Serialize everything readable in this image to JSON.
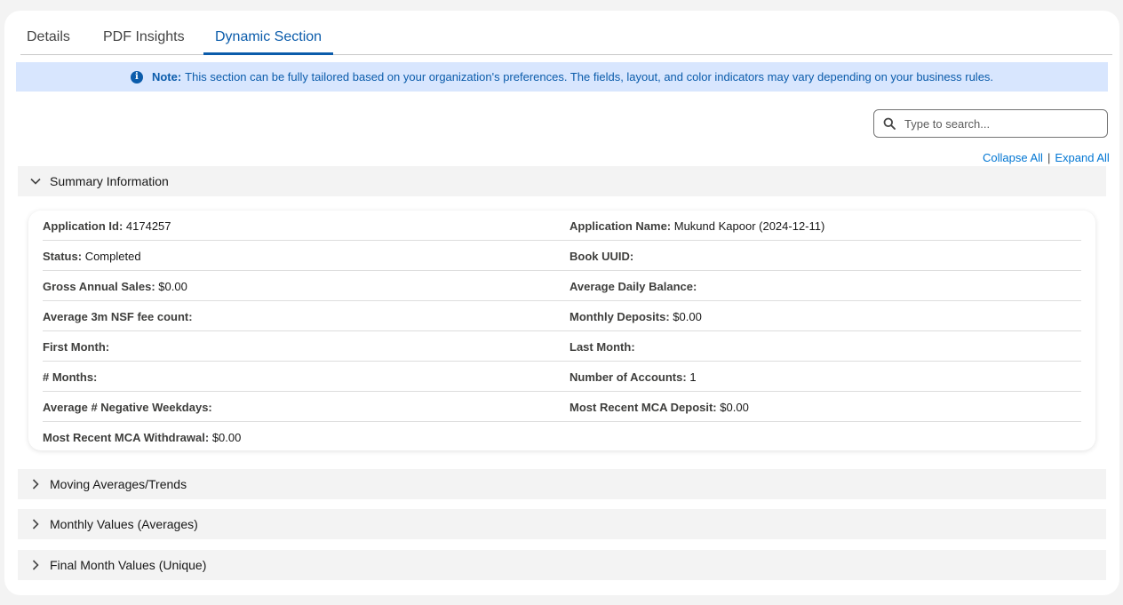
{
  "tabs": [
    {
      "label": "Details",
      "active": false
    },
    {
      "label": "PDF Insights",
      "active": false
    },
    {
      "label": "Dynamic Section",
      "active": true
    }
  ],
  "note": {
    "prefix": "Note:",
    "text": "This section can be fully tailored based on your organization's preferences. The fields, layout, and color indicators may vary depending on your business rules."
  },
  "search": {
    "placeholder": "Type to search...",
    "value": ""
  },
  "links": {
    "collapse_all": "Collapse All",
    "separator": "|",
    "expand_all": "Expand All"
  },
  "sections": [
    {
      "title": "Summary Information",
      "expanded": true
    },
    {
      "title": "Moving Averages/Trends",
      "expanded": false
    },
    {
      "title": "Monthly Values (Averages)",
      "expanded": false
    },
    {
      "title": "Final Month Values (Unique)",
      "expanded": false
    }
  ],
  "summary": {
    "rows": [
      {
        "left": {
          "label": "Application Id:",
          "value": "4174257"
        },
        "right": {
          "label": "Application Name:",
          "value": "Mukund Kapoor (2024-12-11)"
        }
      },
      {
        "left": {
          "label": "Status:",
          "value": "Completed"
        },
        "right": {
          "label": "Book UUID:",
          "value": ""
        }
      },
      {
        "left": {
          "label": "Gross Annual Sales:",
          "value": "$0.00"
        },
        "right": {
          "label": "Average Daily Balance:",
          "value": ""
        }
      },
      {
        "left": {
          "label": "Average 3m NSF fee count:",
          "value": ""
        },
        "right": {
          "label": "Monthly Deposits:",
          "value": "$0.00"
        }
      },
      {
        "left": {
          "label": "First Month:",
          "value": ""
        },
        "right": {
          "label": "Last Month:",
          "value": ""
        }
      },
      {
        "left": {
          "label": "# Months:",
          "value": ""
        },
        "right": {
          "label": "Number of Accounts:",
          "value": "1"
        }
      },
      {
        "left": {
          "label": "Average # Negative Weekdays:",
          "value": ""
        },
        "right": {
          "label": "Most Recent MCA Deposit:",
          "value": "$0.00"
        }
      },
      {
        "left": {
          "label": "Most Recent MCA Withdrawal:",
          "value": "$0.00"
        },
        "right": {
          "label": "",
          "value": ""
        }
      }
    ]
  },
  "colors": {
    "accent": "#0b5cab",
    "link": "#0176d3",
    "note_bg": "#d8e6fe",
    "section_bg": "#f3f3f3"
  },
  "icons": {
    "info": "info-icon",
    "search": "search-icon",
    "expanded": "chevron-down-icon",
    "collapsed": "chevron-right-icon"
  }
}
